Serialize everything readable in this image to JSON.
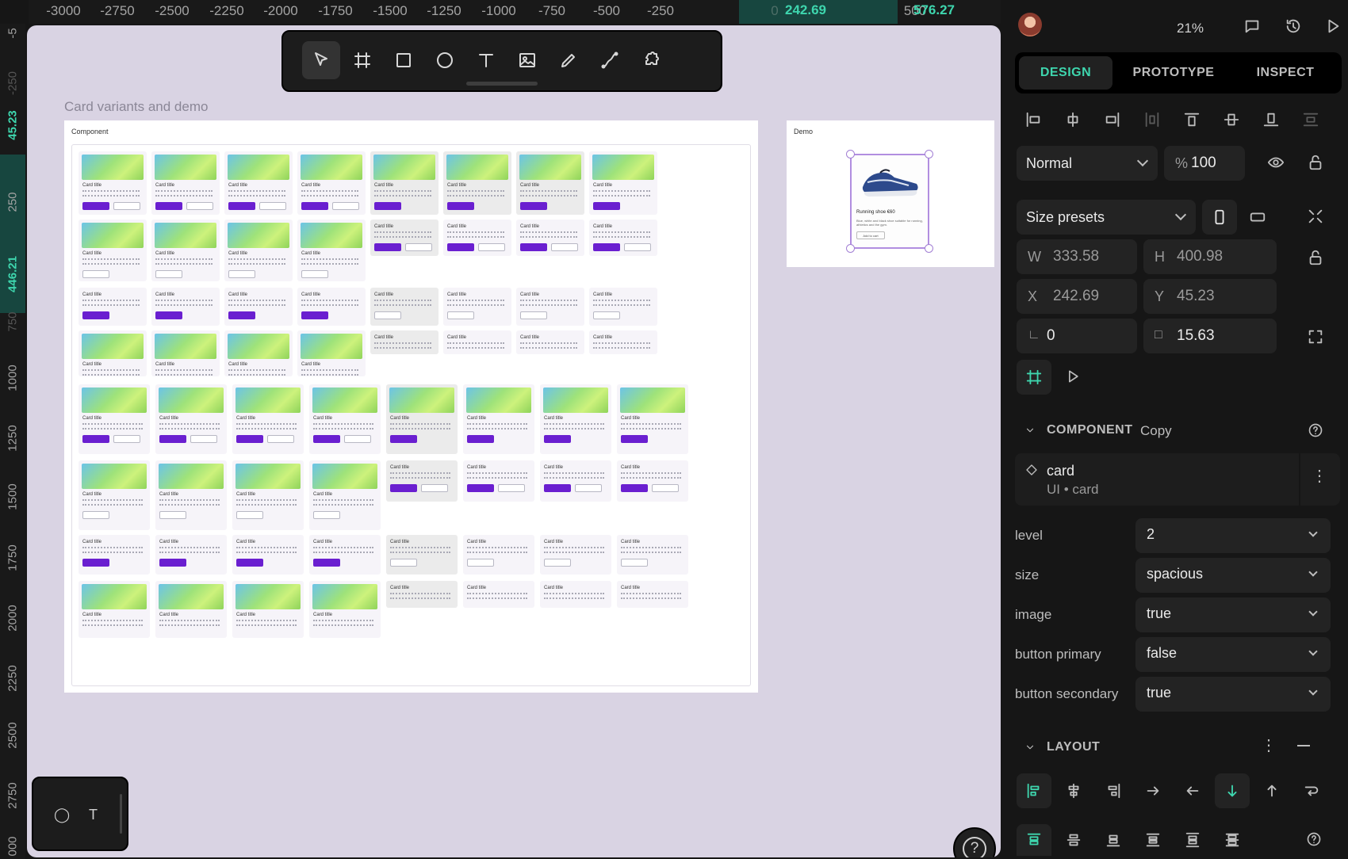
{
  "ruler": {
    "top_ticks": [
      "-3000",
      "-2750",
      "-2500",
      "-2250",
      "-2000",
      "-1750",
      "-1500",
      "-1250",
      "-1000",
      "-750",
      "-500",
      "-250",
      "0",
      "500"
    ],
    "top_selection_start": "242.69",
    "top_selection_end": "576.27",
    "left_ticks": [
      "-5",
      "250",
      "750",
      "1000",
      "1250",
      "1500",
      "1750",
      "2000",
      "2250",
      "2500",
      "2750",
      "000"
    ],
    "left_faded_tick": "-250",
    "left_selection_start": "45.23",
    "left_selection_end": "446.21"
  },
  "toolbar": {
    "tools": [
      "move-tool",
      "board-tool",
      "rectangle-tool",
      "ellipse-tool",
      "text-tool",
      "image-tool",
      "pencil-tool",
      "path-tool",
      "plugins-tool"
    ],
    "active": "move-tool"
  },
  "canvas": {
    "section_label": "Card variants and demo",
    "component_label": "Component",
    "demo_label": "Demo",
    "card_title": "Card title",
    "demo_card": {
      "title": "Running shoe €60",
      "description": "Blue, white and black shoe suitable for running, athletics and the gym.",
      "button": "Add to cart"
    }
  },
  "panel": {
    "zoom": "21%",
    "tabs": [
      "DESIGN",
      "PROTOTYPE",
      "INSPECT"
    ],
    "active_tab": "DESIGN",
    "blend_mode": "Normal",
    "opacity_symbol": "%",
    "opacity": "100",
    "size_presets": "Size presets",
    "width_label": "W",
    "width": "333.58",
    "height_label": "H",
    "height": "400.98",
    "x_label": "X",
    "x": "242.69",
    "y_label": "Y",
    "y": "45.23",
    "rotation": "0",
    "radius": "15.63",
    "component_section": "COMPONENT",
    "component_action": "Copy",
    "component_name": "card",
    "component_path": "UI • card",
    "props": [
      {
        "label": "level",
        "value": "2"
      },
      {
        "label": "size",
        "value": "spacious"
      },
      {
        "label": "image",
        "value": "true"
      },
      {
        "label": "button primary",
        "value": "false"
      },
      {
        "label": "button secondary",
        "value": "true"
      }
    ],
    "layout_section": "LAYOUT"
  },
  "colors": {
    "accent": "#3ed6ae",
    "canvas_bg": "#d9d3e3",
    "primary_button": "#6a1fd0",
    "selection": "#b18ee0"
  }
}
